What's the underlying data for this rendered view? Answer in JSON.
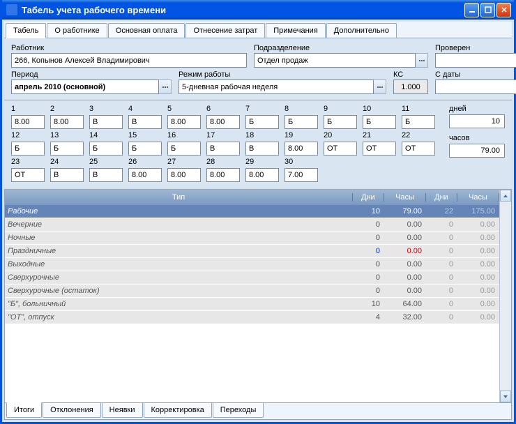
{
  "window": {
    "title": "Табель учета рабочего времени"
  },
  "tabs_top": [
    {
      "label": "Табель",
      "active": true
    },
    {
      "label": "О работнике"
    },
    {
      "label": "Основная оплата"
    },
    {
      "label": "Отнесение затрат"
    },
    {
      "label": "Примечания"
    },
    {
      "label": "Дополнительно"
    }
  ],
  "form": {
    "employee_label": "Работник",
    "employee_value": "266, Копынов Алексей Владимирович",
    "department_label": "Подразделение",
    "department_value": "Отдел продаж",
    "checked_label": "Проверен",
    "checked_value": "",
    "period_label": "Период",
    "period_value": "апрель 2010 (основной)",
    "regime_label": "Режим работы",
    "regime_value": "5-дневная рабочая неделя",
    "kc_label": "КС",
    "kc_value": "1.000",
    "sdate_label": "С даты",
    "sdate_value": ""
  },
  "calendar": {
    "days": [
      {
        "n": "1",
        "v": "8.00"
      },
      {
        "n": "2",
        "v": "8.00"
      },
      {
        "n": "3",
        "v": "В"
      },
      {
        "n": "4",
        "v": "В"
      },
      {
        "n": "5",
        "v": "8.00"
      },
      {
        "n": "6",
        "v": "8.00"
      },
      {
        "n": "7",
        "v": "Б"
      },
      {
        "n": "8",
        "v": "Б"
      },
      {
        "n": "9",
        "v": "Б"
      },
      {
        "n": "10",
        "v": "Б"
      },
      {
        "n": "11",
        "v": "Б"
      },
      {
        "n": "12",
        "v": "Б"
      },
      {
        "n": "13",
        "v": "Б"
      },
      {
        "n": "14",
        "v": "Б"
      },
      {
        "n": "15",
        "v": "Б"
      },
      {
        "n": "16",
        "v": "Б"
      },
      {
        "n": "17",
        "v": "В"
      },
      {
        "n": "18",
        "v": "В"
      },
      {
        "n": "19",
        "v": "8.00"
      },
      {
        "n": "20",
        "v": "ОТ"
      },
      {
        "n": "21",
        "v": "ОТ"
      },
      {
        "n": "22",
        "v": "ОТ"
      },
      {
        "n": "23",
        "v": "ОТ"
      },
      {
        "n": "24",
        "v": "В"
      },
      {
        "n": "25",
        "v": "В"
      },
      {
        "n": "26",
        "v": "8.00"
      },
      {
        "n": "27",
        "v": "8.00"
      },
      {
        "n": "28",
        "v": "8.00"
      },
      {
        "n": "29",
        "v": "8.00"
      },
      {
        "n": "30",
        "v": "7.00"
      }
    ],
    "summary": {
      "days_label": "дней",
      "days_value": "10",
      "hours_label": "часов",
      "hours_value": "79.00"
    }
  },
  "table": {
    "headers": {
      "type": "Тип",
      "days1": "Дни",
      "hours1": "Часы",
      "days2": "Дни",
      "hours2": "Часы"
    },
    "rows": [
      {
        "type": "Рабочие",
        "d1": "10",
        "h1": "79.00",
        "d2": "22",
        "h2": "175.00",
        "selected": true
      },
      {
        "type": "Вечерние",
        "d1": "0",
        "h1": "0.00",
        "d2": "0",
        "h2": "0.00"
      },
      {
        "type": "Ночные",
        "d1": "0",
        "h1": "0.00",
        "d2": "0",
        "h2": "0.00"
      },
      {
        "type": "Праздничные",
        "d1": "0",
        "h1": "0.00",
        "d2": "0",
        "h2": "0.00",
        "special": true
      },
      {
        "type": "Выходные",
        "d1": "0",
        "h1": "0.00",
        "d2": "0",
        "h2": "0.00"
      },
      {
        "type": "Сверхурочные",
        "d1": "0",
        "h1": "0.00",
        "d2": "0",
        "h2": "0.00"
      },
      {
        "type": "Сверхурочные (остаток)",
        "d1": "0",
        "h1": "0.00",
        "d2": "0",
        "h2": "0.00"
      },
      {
        "type": "\"Б\", больничный",
        "d1": "10",
        "h1": "64.00",
        "d2": "0",
        "h2": "0.00"
      },
      {
        "type": "\"ОТ\", отпуск",
        "d1": "4",
        "h1": "32.00",
        "d2": "0",
        "h2": "0.00"
      }
    ]
  },
  "tabs_bottom": [
    {
      "label": "Итоги",
      "active": true
    },
    {
      "label": "Отклонения"
    },
    {
      "label": "Неявки"
    },
    {
      "label": "Корректировка"
    },
    {
      "label": "Переходы"
    }
  ]
}
